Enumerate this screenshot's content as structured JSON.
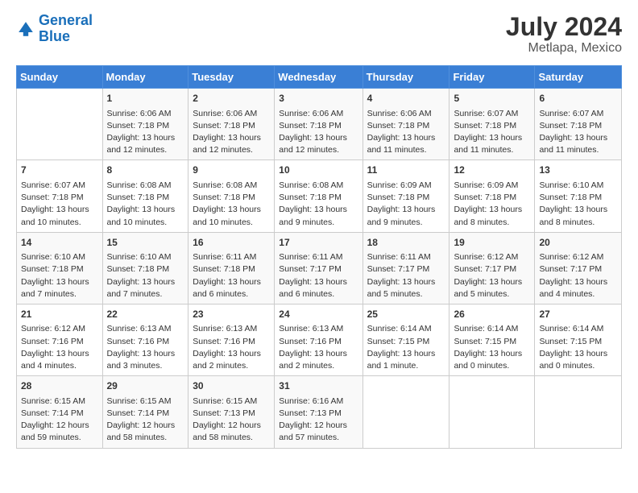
{
  "logo": {
    "line1": "General",
    "line2": "Blue"
  },
  "title": "July 2024",
  "location": "Metlapa, Mexico",
  "days_header": [
    "Sunday",
    "Monday",
    "Tuesday",
    "Wednesday",
    "Thursday",
    "Friday",
    "Saturday"
  ],
  "weeks": [
    [
      {
        "day": "",
        "sunrise": "",
        "sunset": "",
        "daylight": ""
      },
      {
        "day": "1",
        "sunrise": "Sunrise: 6:06 AM",
        "sunset": "Sunset: 7:18 PM",
        "daylight": "Daylight: 13 hours and 12 minutes."
      },
      {
        "day": "2",
        "sunrise": "Sunrise: 6:06 AM",
        "sunset": "Sunset: 7:18 PM",
        "daylight": "Daylight: 13 hours and 12 minutes."
      },
      {
        "day": "3",
        "sunrise": "Sunrise: 6:06 AM",
        "sunset": "Sunset: 7:18 PM",
        "daylight": "Daylight: 13 hours and 12 minutes."
      },
      {
        "day": "4",
        "sunrise": "Sunrise: 6:06 AM",
        "sunset": "Sunset: 7:18 PM",
        "daylight": "Daylight: 13 hours and 11 minutes."
      },
      {
        "day": "5",
        "sunrise": "Sunrise: 6:07 AM",
        "sunset": "Sunset: 7:18 PM",
        "daylight": "Daylight: 13 hours and 11 minutes."
      },
      {
        "day": "6",
        "sunrise": "Sunrise: 6:07 AM",
        "sunset": "Sunset: 7:18 PM",
        "daylight": "Daylight: 13 hours and 11 minutes."
      }
    ],
    [
      {
        "day": "7",
        "sunrise": "Sunrise: 6:07 AM",
        "sunset": "Sunset: 7:18 PM",
        "daylight": "Daylight: 13 hours and 10 minutes."
      },
      {
        "day": "8",
        "sunrise": "Sunrise: 6:08 AM",
        "sunset": "Sunset: 7:18 PM",
        "daylight": "Daylight: 13 hours and 10 minutes."
      },
      {
        "day": "9",
        "sunrise": "Sunrise: 6:08 AM",
        "sunset": "Sunset: 7:18 PM",
        "daylight": "Daylight: 13 hours and 10 minutes."
      },
      {
        "day": "10",
        "sunrise": "Sunrise: 6:08 AM",
        "sunset": "Sunset: 7:18 PM",
        "daylight": "Daylight: 13 hours and 9 minutes."
      },
      {
        "day": "11",
        "sunrise": "Sunrise: 6:09 AM",
        "sunset": "Sunset: 7:18 PM",
        "daylight": "Daylight: 13 hours and 9 minutes."
      },
      {
        "day": "12",
        "sunrise": "Sunrise: 6:09 AM",
        "sunset": "Sunset: 7:18 PM",
        "daylight": "Daylight: 13 hours and 8 minutes."
      },
      {
        "day": "13",
        "sunrise": "Sunrise: 6:10 AM",
        "sunset": "Sunset: 7:18 PM",
        "daylight": "Daylight: 13 hours and 8 minutes."
      }
    ],
    [
      {
        "day": "14",
        "sunrise": "Sunrise: 6:10 AM",
        "sunset": "Sunset: 7:18 PM",
        "daylight": "Daylight: 13 hours and 7 minutes."
      },
      {
        "day": "15",
        "sunrise": "Sunrise: 6:10 AM",
        "sunset": "Sunset: 7:18 PM",
        "daylight": "Daylight: 13 hours and 7 minutes."
      },
      {
        "day": "16",
        "sunrise": "Sunrise: 6:11 AM",
        "sunset": "Sunset: 7:18 PM",
        "daylight": "Daylight: 13 hours and 6 minutes."
      },
      {
        "day": "17",
        "sunrise": "Sunrise: 6:11 AM",
        "sunset": "Sunset: 7:17 PM",
        "daylight": "Daylight: 13 hours and 6 minutes."
      },
      {
        "day": "18",
        "sunrise": "Sunrise: 6:11 AM",
        "sunset": "Sunset: 7:17 PM",
        "daylight": "Daylight: 13 hours and 5 minutes."
      },
      {
        "day": "19",
        "sunrise": "Sunrise: 6:12 AM",
        "sunset": "Sunset: 7:17 PM",
        "daylight": "Daylight: 13 hours and 5 minutes."
      },
      {
        "day": "20",
        "sunrise": "Sunrise: 6:12 AM",
        "sunset": "Sunset: 7:17 PM",
        "daylight": "Daylight: 13 hours and 4 minutes."
      }
    ],
    [
      {
        "day": "21",
        "sunrise": "Sunrise: 6:12 AM",
        "sunset": "Sunset: 7:16 PM",
        "daylight": "Daylight: 13 hours and 4 minutes."
      },
      {
        "day": "22",
        "sunrise": "Sunrise: 6:13 AM",
        "sunset": "Sunset: 7:16 PM",
        "daylight": "Daylight: 13 hours and 3 minutes."
      },
      {
        "day": "23",
        "sunrise": "Sunrise: 6:13 AM",
        "sunset": "Sunset: 7:16 PM",
        "daylight": "Daylight: 13 hours and 2 minutes."
      },
      {
        "day": "24",
        "sunrise": "Sunrise: 6:13 AM",
        "sunset": "Sunset: 7:16 PM",
        "daylight": "Daylight: 13 hours and 2 minutes."
      },
      {
        "day": "25",
        "sunrise": "Sunrise: 6:14 AM",
        "sunset": "Sunset: 7:15 PM",
        "daylight": "Daylight: 13 hours and 1 minute."
      },
      {
        "day": "26",
        "sunrise": "Sunrise: 6:14 AM",
        "sunset": "Sunset: 7:15 PM",
        "daylight": "Daylight: 13 hours and 0 minutes."
      },
      {
        "day": "27",
        "sunrise": "Sunrise: 6:14 AM",
        "sunset": "Sunset: 7:15 PM",
        "daylight": "Daylight: 13 hours and 0 minutes."
      }
    ],
    [
      {
        "day": "28",
        "sunrise": "Sunrise: 6:15 AM",
        "sunset": "Sunset: 7:14 PM",
        "daylight": "Daylight: 12 hours and 59 minutes."
      },
      {
        "day": "29",
        "sunrise": "Sunrise: 6:15 AM",
        "sunset": "Sunset: 7:14 PM",
        "daylight": "Daylight: 12 hours and 58 minutes."
      },
      {
        "day": "30",
        "sunrise": "Sunrise: 6:15 AM",
        "sunset": "Sunset: 7:13 PM",
        "daylight": "Daylight: 12 hours and 58 minutes."
      },
      {
        "day": "31",
        "sunrise": "Sunrise: 6:16 AM",
        "sunset": "Sunset: 7:13 PM",
        "daylight": "Daylight: 12 hours and 57 minutes."
      },
      {
        "day": "",
        "sunrise": "",
        "sunset": "",
        "daylight": ""
      },
      {
        "day": "",
        "sunrise": "",
        "sunset": "",
        "daylight": ""
      },
      {
        "day": "",
        "sunrise": "",
        "sunset": "",
        "daylight": ""
      }
    ]
  ]
}
